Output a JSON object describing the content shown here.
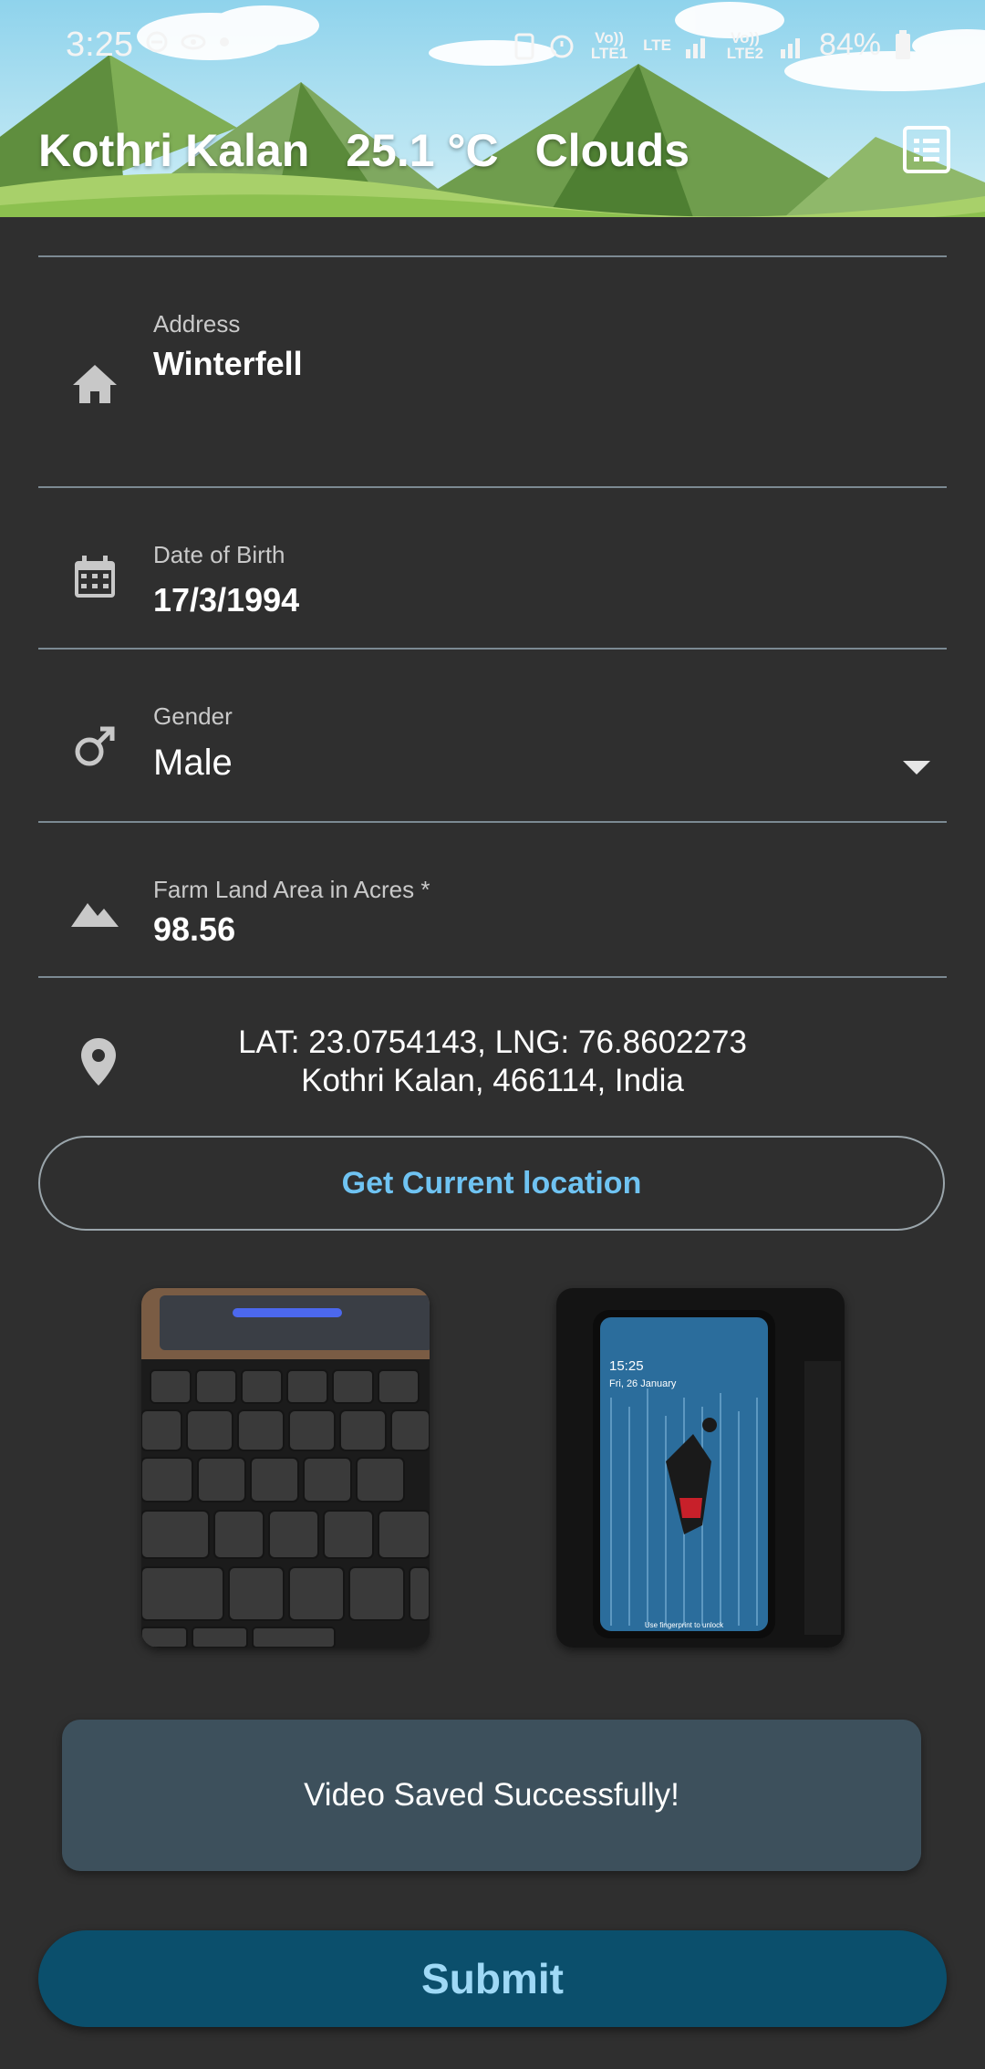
{
  "status_bar": {
    "time": "3:25",
    "network_1": "Vo)) LTE1",
    "network_lte": "LTE",
    "network_2": "Vo)) LTE2",
    "battery": "84%"
  },
  "header": {
    "location": "Kothri Kalan",
    "temperature": "25.1 °C",
    "weather": "Clouds",
    "menu_icon": "list-icon"
  },
  "form": {
    "address": {
      "label": "Address",
      "value": "Winterfell",
      "icon": "home-icon"
    },
    "dob": {
      "label": "Date of Birth",
      "value": "17/3/1994",
      "icon": "calendar-icon"
    },
    "gender": {
      "label": "Gender",
      "value": "Male",
      "icon": "male-icon"
    },
    "farm_area": {
      "label": "Farm Land Area in Acres *",
      "value": "98.56",
      "icon": "terrain-icon"
    }
  },
  "location": {
    "coords": "LAT: 23.0754143, LNG: 76.8602273",
    "place": "Kothri Kalan, 466114, India",
    "icon": "map-pin-icon",
    "button_label": "Get Current location"
  },
  "photos": {
    "phone_time": "15:25",
    "phone_date": "Fri, 26 January",
    "phone_hint": "Use fingerprint to unlock"
  },
  "toast": {
    "message": "Video Saved Successfully!"
  },
  "submit": {
    "label": "Submit"
  },
  "colors": {
    "background": "#2f2f2f",
    "accent_link": "#6fc3f2",
    "submit_bg": "#0b4f6c",
    "toast_bg": "#3d505c"
  }
}
